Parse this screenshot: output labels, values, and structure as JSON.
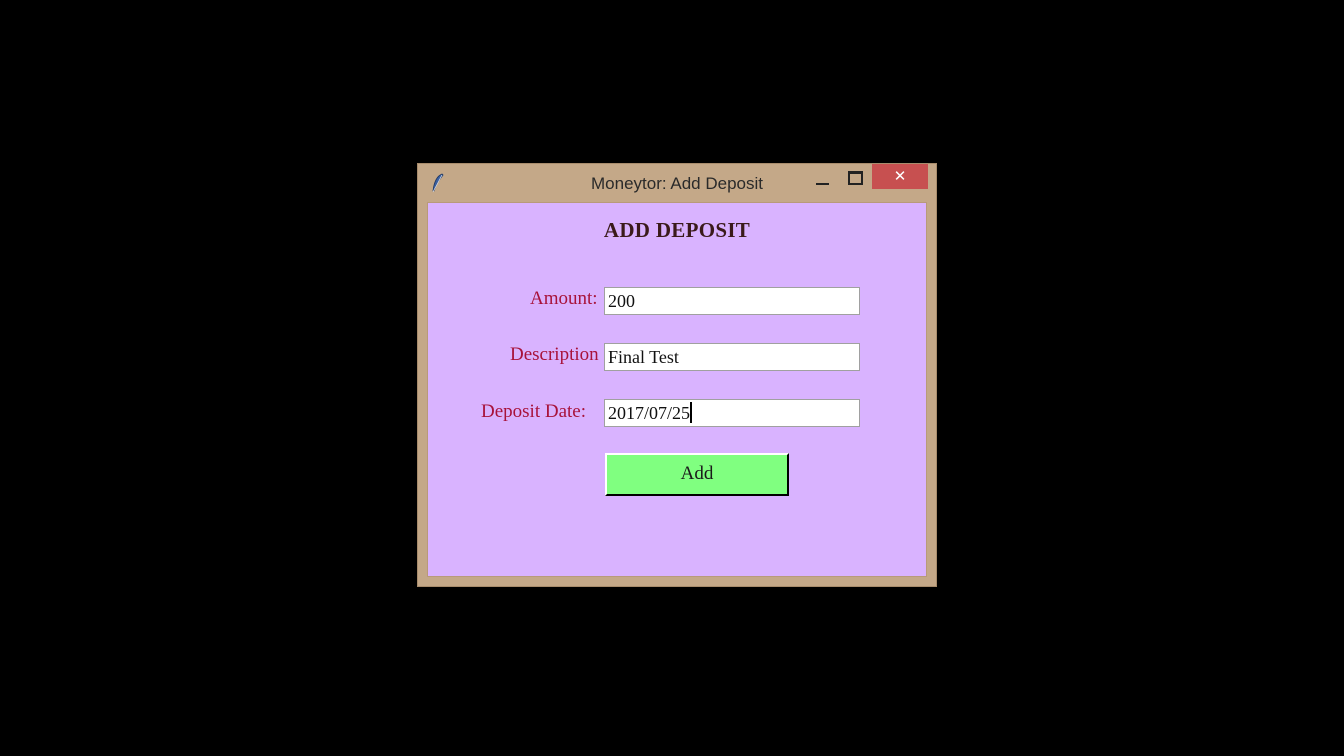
{
  "window": {
    "title": "Moneytor: Add Deposit",
    "close_glyph": "✕"
  },
  "form": {
    "heading": "ADD DEPOSIT",
    "amount_label": "Amount:",
    "amount_value": "200",
    "description_label": "Description",
    "description_value": "Final Test",
    "date_label": "Deposit Date:",
    "date_value": "2017/07/25",
    "add_label": "Add"
  },
  "colors": {
    "window_frame": "#c4a888",
    "background": "#d9b3ff",
    "label_text": "#a8123a",
    "add_button": "#80ff80",
    "close_button": "#c75050"
  },
  "icons": [
    "feather-icon",
    "minimize-icon",
    "maximize-icon",
    "close-icon"
  ]
}
